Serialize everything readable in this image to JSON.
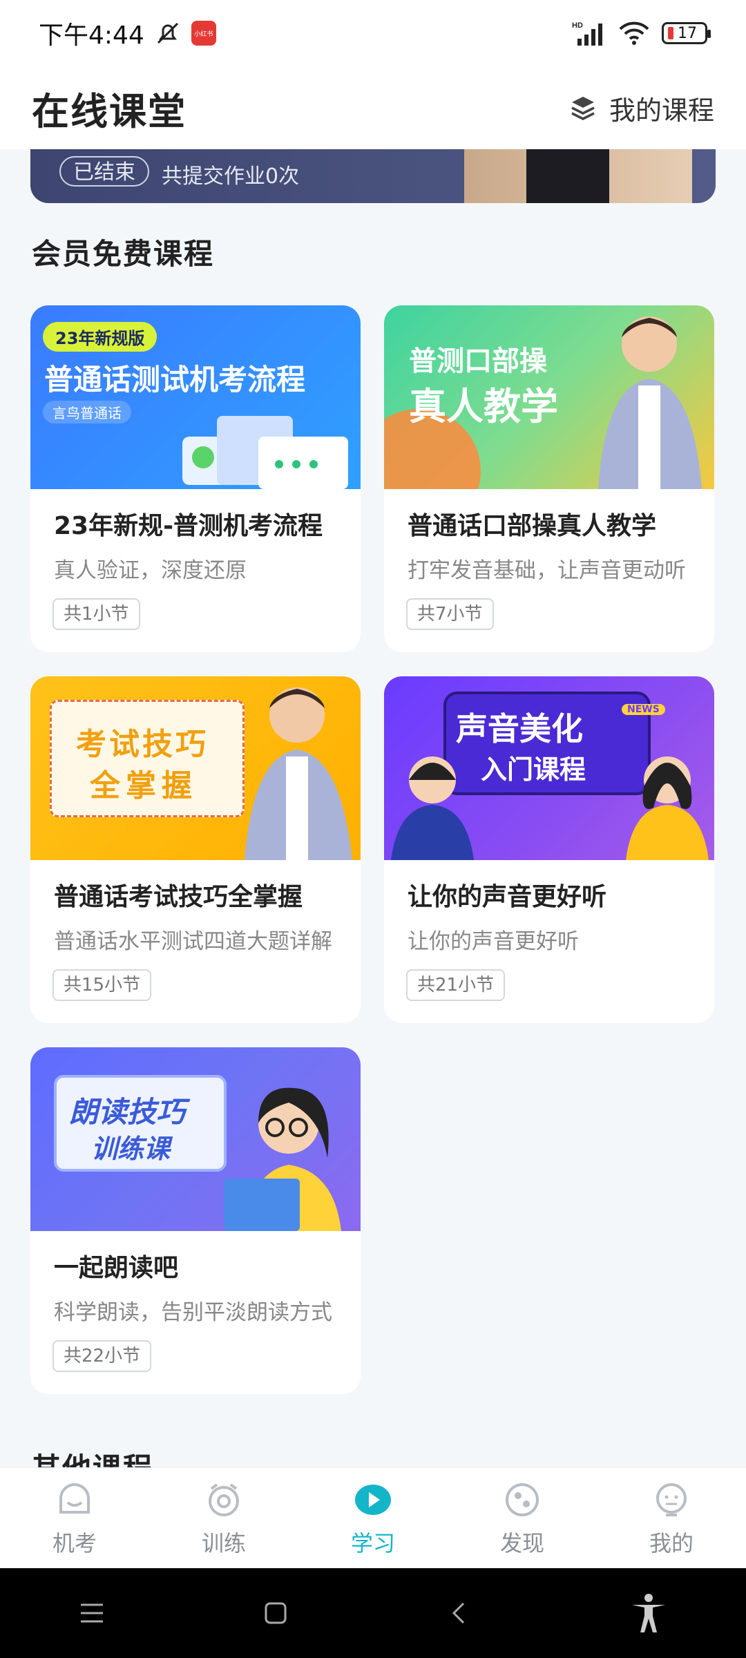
{
  "status": {
    "time": "下午4:44",
    "app_badge": "小红书",
    "network": "HD",
    "battery": "17"
  },
  "header": {
    "title": "在线课堂",
    "my_courses": "我的课程"
  },
  "banner": {
    "status": "已结束",
    "text": "共提交作业0次"
  },
  "sections": {
    "free": "会员免费课程",
    "other": "其他课程"
  },
  "courses": [
    {
      "thumb_badge": "23年新规版",
      "thumb_title": "普通话测试机考流程",
      "thumb_brand": "言鸟普通话",
      "title": "23年新规-普测机考流程",
      "subtitle": "真人验证，深度还原",
      "tag": "共1小节"
    },
    {
      "thumb_title_1": "普测口部操",
      "thumb_title_2": "真人教学",
      "title": "普通话口部操真人教学",
      "subtitle": "打牢发音基础，让声音更动听",
      "tag": "共7小节"
    },
    {
      "thumb_title_1": "考试技巧",
      "thumb_title_2": "全掌握",
      "title": "普通话考试技巧全掌握",
      "subtitle": "普通话水平测试四道大题详解",
      "tag": "共15小节"
    },
    {
      "thumb_title_1": "声音美化",
      "thumb_title_2": "入门课程",
      "thumb_badge": "NEWS",
      "title": "让你的声音更好听",
      "subtitle": "让你的声音更好听",
      "tag": "共21小节"
    },
    {
      "thumb_title_1": "朗读技巧",
      "thumb_title_2": "训练课",
      "title": "一起朗读吧",
      "subtitle": "科学朗读，告别平淡朗读方式",
      "tag": "共22小节"
    }
  ],
  "tabs": [
    {
      "label": "机考",
      "icon": "exam-icon"
    },
    {
      "label": "训练",
      "icon": "alarm-clock-icon"
    },
    {
      "label": "学习",
      "icon": "play-icon",
      "active": true
    },
    {
      "label": "发现",
      "icon": "compass-icon"
    },
    {
      "label": "我的",
      "icon": "face-icon"
    }
  ],
  "colors": {
    "accent": "#13b5c9",
    "background": "#f4f7fa"
  }
}
